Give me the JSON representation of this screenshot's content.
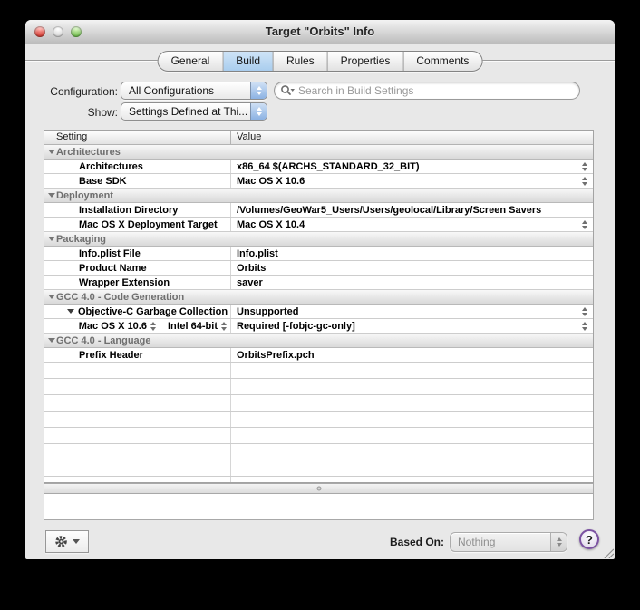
{
  "window": {
    "title": "Target \"Orbits\" Info",
    "tabs": [
      {
        "label": "General",
        "selected": false
      },
      {
        "label": "Build",
        "selected": true
      },
      {
        "label": "Rules",
        "selected": false
      },
      {
        "label": "Properties",
        "selected": false
      },
      {
        "label": "Comments",
        "selected": false
      }
    ],
    "toolbar": {
      "configuration_label": "Configuration:",
      "configuration_value": "All Configurations",
      "show_label": "Show:",
      "show_value": "Settings Defined at Thi...",
      "search_placeholder": "Search in Build Settings"
    },
    "table": {
      "columns": [
        "Setting",
        "Value"
      ],
      "rows": [
        {
          "type": "group",
          "label": "Architectures"
        },
        {
          "type": "setting",
          "label": "Architectures",
          "value": "x86_64 $(ARCHS_STANDARD_32_BIT)",
          "stepper": true
        },
        {
          "type": "setting",
          "label": "Base SDK",
          "value": "Mac OS X 10.6",
          "stepper": true
        },
        {
          "type": "group",
          "label": "Deployment"
        },
        {
          "type": "setting",
          "label": "Installation Directory",
          "value": "/Volumes/GeoWar5_Users/Users/geolocal/Library/Screen Savers",
          "stepper": false
        },
        {
          "type": "setting",
          "label": "Mac OS X Deployment Target",
          "value": "Mac OS X 10.4",
          "stepper": true
        },
        {
          "type": "group",
          "label": "Packaging"
        },
        {
          "type": "setting",
          "label": "Info.plist File",
          "value": "Info.plist",
          "stepper": false
        },
        {
          "type": "setting",
          "label": "Product Name",
          "value": "Orbits",
          "stepper": false
        },
        {
          "type": "setting",
          "label": "Wrapper Extension",
          "value": "saver",
          "stepper": false
        },
        {
          "type": "group",
          "label": "GCC 4.0 - Code Generation"
        },
        {
          "type": "setting",
          "label": "Objective-C Garbage Collection",
          "disclosure": true,
          "value": "Unsupported",
          "stepper": true
        },
        {
          "type": "condition",
          "popups": [
            "Mac OS X 10.6",
            "Intel 64-bit"
          ],
          "value": "Required [-fobjc-gc-only]",
          "stepper": true
        },
        {
          "type": "group",
          "label": "GCC 4.0 - Language"
        },
        {
          "type": "setting",
          "label": "Prefix Header",
          "value": "OrbitsPrefix.pch",
          "stepper": false
        }
      ],
      "empty_row_count": 8
    },
    "footer": {
      "gear_icon": "gear-icon",
      "based_on_label": "Based On:",
      "based_on_value": "Nothing",
      "help_label": "?"
    }
  },
  "colors": {
    "tab_selected_top": "#cfe4f7",
    "tab_selected_bottom": "#a9cdee",
    "popup_cap_top": "#cfe0f5",
    "popup_cap_bottom": "#8cb2e3",
    "group_text": "#6f6f6f",
    "help_ring": "#7b52a1"
  }
}
